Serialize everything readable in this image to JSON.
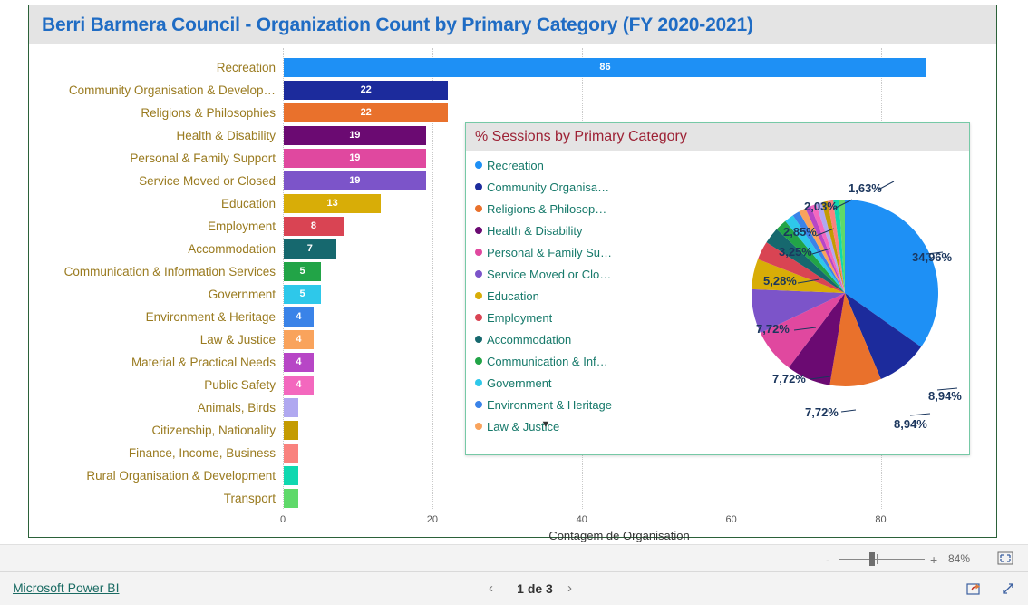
{
  "report": {
    "bar_visual_title": "Berri Barmera Council - Organization Count by Primary Category (FY 2020-2021)",
    "pie_visual_title": "% Sessions by Primary Category",
    "legend_scroll_icon": "chevron-down-icon"
  },
  "zoom_bar": {
    "minus_label": "-",
    "plus_label": "+",
    "zoom_level": "84%",
    "fit_icon": "fit-to-page-icon"
  },
  "footer": {
    "brand_link": "Microsoft Power BI",
    "prev_label": "‹",
    "next_label": "›",
    "page_indicator": "1 de 3",
    "share_icon": "share-icon",
    "fullscreen_icon": "fullscreen-icon"
  },
  "chart_data": [
    {
      "type": "bar",
      "title": "Berri Barmera Council - Organization Count by Primary Category (FY 2020-2021)",
      "orientation": "horizontal",
      "xlabel": "Contagem de Organisation",
      "ylabel": "",
      "xlim": [
        0,
        90
      ],
      "xticks": [
        0,
        20,
        40,
        60,
        80
      ],
      "grid": true,
      "legend": "none",
      "categories": [
        "Recreation",
        "Community Organisation & Develop…",
        "Religions & Philosophies",
        "Health & Disability",
        "Personal & Family Support",
        "Service Moved or Closed",
        "Education",
        "Employment",
        "Accommodation",
        "Communication & Information Services",
        "Government",
        "Environment & Heritage",
        "Law & Justice",
        "Material & Practical Needs",
        "Public Safety",
        "Animals, Birds",
        "Citizenship, Nationality",
        "Finance, Income, Business",
        "Rural Organisation & Development",
        "Transport"
      ],
      "values": [
        86,
        22,
        22,
        19,
        19,
        19,
        13,
        8,
        7,
        5,
        5,
        4,
        4,
        4,
        4,
        2,
        2,
        2,
        2,
        2
      ],
      "value_labels": [
        "86",
        "22",
        "22",
        "19",
        "19",
        "19",
        "13",
        "8",
        "7",
        "5",
        "5",
        "4",
        "4",
        "4",
        "4",
        "",
        "",
        "",
        "",
        ""
      ],
      "colors": [
        "#1e90f5",
        "#1c2b9c",
        "#e9712c",
        "#6b0a72",
        "#e0489f",
        "#7c54c9",
        "#d8ad07",
        "#d94453",
        "#16686e",
        "#22a447",
        "#2ec8ea",
        "#3a83e8",
        "#f9a35c",
        "#b746c6",
        "#f368be",
        "#b0a8f0",
        "#c49b02",
        "#f9827e",
        "#0fd8b0",
        "#5fd96a"
      ]
    },
    {
      "type": "pie",
      "title": "% Sessions by Primary Category",
      "legend_position": "left",
      "labels": [
        "Recreation",
        "Community Organisa…",
        "Religions & Philosop…",
        "Health & Disability",
        "Personal & Family Su…",
        "Service Moved or Clo…",
        "Education",
        "Employment",
        "Accommodation",
        "Communication & Inf…",
        "Government",
        "Environment & Heritage",
        "Law & Justice"
      ],
      "legend_labels": [
        "Recreation",
        "Community Organisa…",
        "Religions & Philosop…",
        "Health & Disability",
        "Personal & Family Su…",
        "Service Moved or Clo…",
        "Education",
        "Employment",
        "Accommodation",
        "Communication & Inf…",
        "Government",
        "Environment & Heritage",
        "Law & Justice"
      ],
      "values": [
        34.96,
        8.94,
        8.94,
        7.72,
        7.72,
        7.72,
        5.28,
        3.25,
        2.85,
        2.03,
        1.63,
        1.22,
        1.22
      ],
      "shown_labels": [
        "34,96%",
        "8,94%",
        "8,94%",
        "7,72%",
        "7,72%",
        "7,72%",
        "5,28%",
        "3,25%",
        "2,85%",
        "2,03%",
        "1,63%",
        "",
        ""
      ],
      "colors": [
        "#1e90f5",
        "#1c2b9c",
        "#e9712c",
        "#6b0a72",
        "#e0489f",
        "#7c54c9",
        "#d8ad07",
        "#d94453",
        "#16686e",
        "#22a447",
        "#2ec8ea",
        "#3a83e8",
        "#f9a35c"
      ],
      "extra_slice_colors": [
        "#b746c6",
        "#f368be",
        "#b0a8f0",
        "#c49b02",
        "#f9827e",
        "#0fd8b0",
        "#5fd96a"
      ],
      "callout_labels": [
        {
          "text": "1,63%",
          "x": 232,
          "y": 32
        },
        {
          "text": "2,03%",
          "x": 183,
          "y": 52
        },
        {
          "text": "2,85%",
          "x": 160,
          "y": 80
        },
        {
          "text": "3,25%",
          "x": 155,
          "y": 102
        },
        {
          "text": "5,28%",
          "x": 138,
          "y": 134
        },
        {
          "text": "7,72%",
          "x": 130,
          "y": 187
        },
        {
          "text": "7,72%",
          "x": 148,
          "y": 242
        },
        {
          "text": "7,72%",
          "x": 184,
          "y": 279
        },
        {
          "text": "8,94%",
          "x": 282,
          "y": 292
        },
        {
          "text": "8,94%",
          "x": 320,
          "y": 261
        },
        {
          "text": "34,96%",
          "x": 302,
          "y": 108
        }
      ]
    }
  ]
}
